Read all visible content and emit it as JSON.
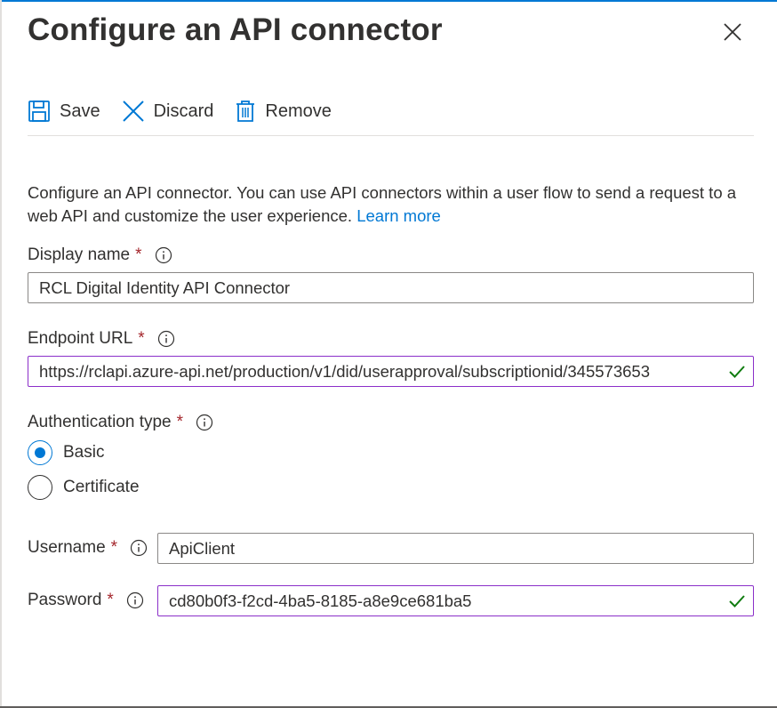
{
  "dialog": {
    "title": "Configure an API connector",
    "close_icon": "close-icon"
  },
  "toolbar": {
    "save_label": "Save",
    "save_icon": "save-icon",
    "discard_label": "Discard",
    "discard_icon": "discard-icon",
    "remove_label": "Remove",
    "remove_icon": "trash-icon"
  },
  "description": {
    "text": "Configure an API connector. You can use API connectors within a user flow to send a request to a web API and customize the user experience.",
    "link": "Learn more"
  },
  "form": {
    "display_name": {
      "label": "Display name",
      "required_marker": "*",
      "value": "RCL Digital Identity API Connector"
    },
    "endpoint_url": {
      "label": "Endpoint URL",
      "required_marker": "*",
      "value": "https://rclapi.azure-api.net/production/v1/did/userapproval/subscriptionid/345573653",
      "valid": true
    },
    "authentication_type": {
      "label": "Authentication type",
      "required_marker": "*",
      "options": [
        "Basic",
        "Certificate"
      ],
      "selected": "Basic"
    },
    "username": {
      "label": "Username",
      "required_marker": "*",
      "value": "ApiClient"
    },
    "password": {
      "label": "Password",
      "required_marker": "*",
      "value": "cd80b0f3-f2cd-4ba5-8185-a8e9ce681ba5",
      "valid": true
    }
  },
  "colors": {
    "accent": "#0078d4",
    "required": "#a4262c",
    "valid_border": "#8b2fc9",
    "valid_check": "#107c10"
  }
}
